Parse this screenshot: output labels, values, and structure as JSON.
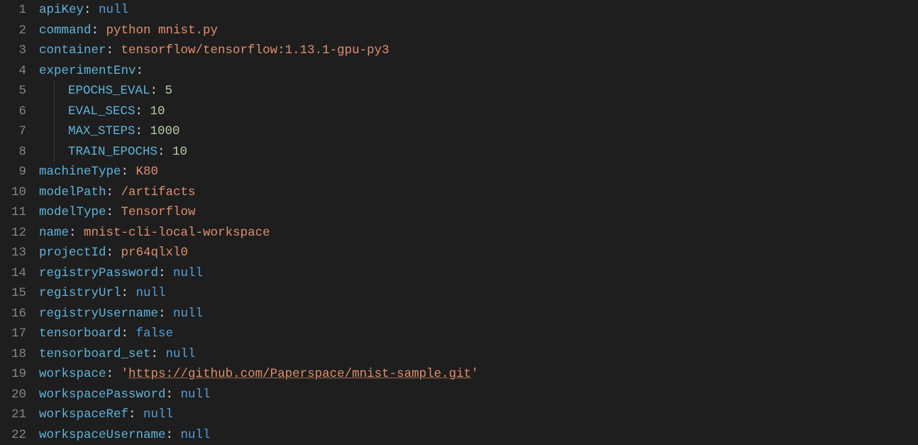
{
  "lineNumbers": [
    "1",
    "2",
    "3",
    "4",
    "5",
    "6",
    "7",
    "8",
    "9",
    "10",
    "11",
    "12",
    "13",
    "14",
    "15",
    "16",
    "17",
    "18",
    "19",
    "20",
    "21",
    "22"
  ],
  "yaml": {
    "apiKey": {
      "key": "apiKey",
      "value": "null",
      "type": "null"
    },
    "command": {
      "key": "command",
      "value": "python mnist.py",
      "type": "str"
    },
    "container": {
      "key": "container",
      "value": "tensorflow/tensorflow:1.13.1-gpu-py3",
      "type": "str"
    },
    "experimentEnv": {
      "key": "experimentEnv"
    },
    "epochsEval": {
      "key": "EPOCHS_EVAL",
      "value": "5",
      "type": "num"
    },
    "evalSecs": {
      "key": "EVAL_SECS",
      "value": "10",
      "type": "num"
    },
    "maxSteps": {
      "key": "MAX_STEPS",
      "value": "1000",
      "type": "num"
    },
    "trainEpochs": {
      "key": "TRAIN_EPOCHS",
      "value": "10",
      "type": "num"
    },
    "machineType": {
      "key": "machineType",
      "value": "K80",
      "type": "str"
    },
    "modelPath": {
      "key": "modelPath",
      "value": "/artifacts",
      "type": "str"
    },
    "modelType": {
      "key": "modelType",
      "value": "Tensorflow",
      "type": "str"
    },
    "name": {
      "key": "name",
      "value": "mnist-cli-local-workspace",
      "type": "str"
    },
    "projectId": {
      "key": "projectId",
      "value": "pr64qlxl0",
      "type": "str"
    },
    "registryPassword": {
      "key": "registryPassword",
      "value": "null",
      "type": "null"
    },
    "registryUrl": {
      "key": "registryUrl",
      "value": "null",
      "type": "null"
    },
    "registryUsername": {
      "key": "registryUsername",
      "value": "null",
      "type": "null"
    },
    "tensorboard": {
      "key": "tensorboard",
      "value": "false",
      "type": "bool"
    },
    "tensorboardSet": {
      "key": "tensorboard_set",
      "value": "null",
      "type": "null"
    },
    "workspace": {
      "key": "workspace",
      "quote": "'",
      "value": "https://github.com/Paperspace/mnist-sample.git",
      "type": "link"
    },
    "workspacePassword": {
      "key": "workspacePassword",
      "value": "null",
      "type": "null"
    },
    "workspaceRef": {
      "key": "workspaceRef",
      "value": "null",
      "type": "null"
    },
    "workspaceUsername": {
      "key": "workspaceUsername",
      "value": "null",
      "type": "null"
    }
  }
}
